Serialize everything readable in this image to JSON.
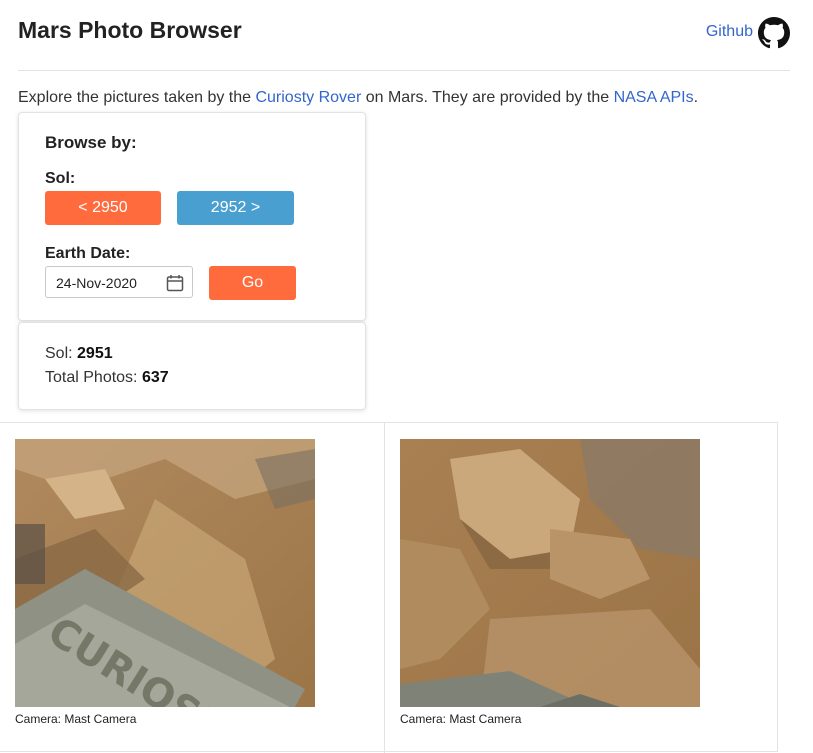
{
  "header": {
    "title": "Mars Photo Browser",
    "github_label": "Github"
  },
  "intro": {
    "before": "Explore the pictures taken by the ",
    "link1": "Curiosty Rover",
    "middle": " on Mars. They are provided by the ",
    "link2": "NASA APIs",
    "after": "."
  },
  "browse": {
    "title": "Browse by:",
    "sol_label": "Sol:",
    "prev_button": "< 2950",
    "next_button": "2952 >",
    "earth_date_label": "Earth Date:",
    "earth_date_value": "24-Nov-2020",
    "go_button": "Go"
  },
  "info": {
    "sol_label": "Sol: ",
    "sol_value": "2951",
    "total_label": "Total Photos: ",
    "total_value": "637"
  },
  "photos": [
    {
      "caption": "Camera: Mast Camera"
    },
    {
      "caption": "Camera: Mast Camera"
    }
  ],
  "colors": {
    "link": "#3366cc",
    "orange_button": "#ff6b3d",
    "blue_button": "#4a9fd1"
  },
  "icons": [
    "github-icon",
    "calendar-icon"
  ]
}
